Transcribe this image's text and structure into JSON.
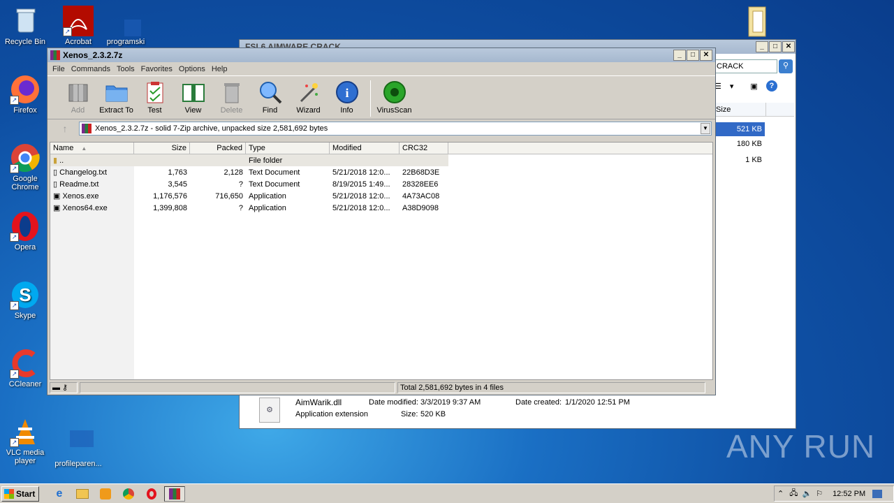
{
  "desktop": {
    "icons": [
      {
        "label": "Recycle Bin"
      },
      {
        "label": "Acrobat"
      },
      {
        "label": "programski"
      },
      {
        "label": "Firefox"
      },
      {
        "label": "Google Chrome"
      },
      {
        "label": "Opera"
      },
      {
        "label": "Skype"
      },
      {
        "label": "CCleaner"
      },
      {
        "label": "VLC media player"
      },
      {
        "label": "profileparen..."
      }
    ],
    "watermark": "ANY RUN"
  },
  "explorer": {
    "title": "FSL6 AIMWARE CRACK",
    "search_text": "CRACK",
    "size_header": "Size",
    "sizes": [
      "521 KB",
      "180 KB",
      "1 KB"
    ],
    "details": {
      "filename": "AimWarik.dll",
      "type": "Application extension",
      "date_modified_label": "Date modified:",
      "date_modified": "3/3/2019 9:37 AM",
      "date_created_label": "Date created:",
      "date_created": "1/1/2020 12:51 PM",
      "size_label": "Size:",
      "size": "520 KB"
    }
  },
  "winrar": {
    "title": "Xenos_2.3.2.7z",
    "menu": [
      "File",
      "Commands",
      "Tools",
      "Favorites",
      "Options",
      "Help"
    ],
    "toolbar": [
      {
        "label": "Add",
        "icon": "add-archive-icon",
        "enabled": false
      },
      {
        "label": "Extract To",
        "icon": "extract-folder-icon",
        "enabled": true
      },
      {
        "label": "Test",
        "icon": "test-clipboard-icon",
        "enabled": true
      },
      {
        "label": "View",
        "icon": "view-book-icon",
        "enabled": true
      },
      {
        "label": "Delete",
        "icon": "trash-icon",
        "enabled": false
      },
      {
        "label": "Find",
        "icon": "magnifier-icon",
        "enabled": true
      },
      {
        "label": "Wizard",
        "icon": "wand-icon",
        "enabled": true
      },
      {
        "label": "Info",
        "icon": "info-icon",
        "enabled": true
      },
      {
        "label": "VirusScan",
        "icon": "virus-icon",
        "enabled": true
      }
    ],
    "address": "Xenos_2.3.2.7z - solid 7-Zip archive, unpacked size 2,581,692 bytes",
    "columns": [
      "Name",
      "Size",
      "Packed",
      "Type",
      "Modified",
      "CRC32"
    ],
    "rows": [
      {
        "name": "..",
        "size": "",
        "packed": "",
        "type": "File folder",
        "modified": "",
        "crc": ""
      },
      {
        "name": "Changelog.txt",
        "size": "1,763",
        "packed": "2,128",
        "type": "Text Document",
        "modified": "5/21/2018 12:0...",
        "crc": "22B68D3E"
      },
      {
        "name": "Readme.txt",
        "size": "3,545",
        "packed": "?",
        "type": "Text Document",
        "modified": "8/19/2015 1:49...",
        "crc": "28328EE6"
      },
      {
        "name": "Xenos.exe",
        "size": "1,176,576",
        "packed": "716,650",
        "type": "Application",
        "modified": "5/21/2018 12:0...",
        "crc": "4A73AC08"
      },
      {
        "name": "Xenos64.exe",
        "size": "1,399,808",
        "packed": "?",
        "type": "Application",
        "modified": "5/21/2018 12:0...",
        "crc": "A38D9098"
      }
    ],
    "status": "Total 2,581,692 bytes in 4 files"
  },
  "taskbar": {
    "start_label": "Start",
    "clock": "12:52 PM"
  }
}
